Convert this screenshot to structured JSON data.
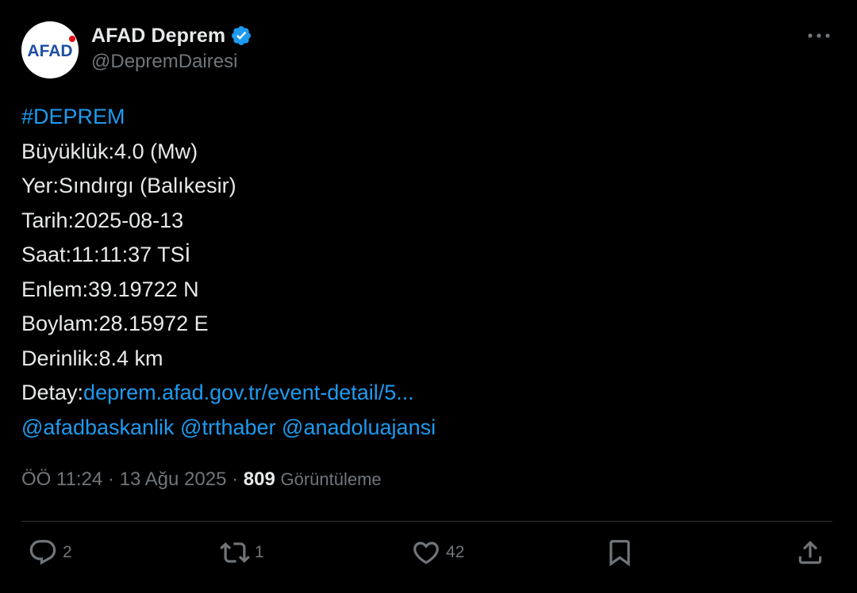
{
  "author": {
    "display_name": "AFAD Deprem",
    "handle": "@DepremDairesi",
    "avatar_text": "AFAD",
    "verified": true
  },
  "tweet": {
    "hashtag": "#DEPREM",
    "lines": {
      "magnitude": "Büyüklük:4.0 (Mw)",
      "location": "Yer:Sındırgı (Balıkesir)",
      "date": "Tarih:2025-08-13",
      "time": "Saat:11:11:37 TSİ",
      "latitude": "Enlem:39.19722 N",
      "longitude": "Boylam:28.15972 E",
      "depth": "Derinlik:8.4 km"
    },
    "detail_label": "Detay:",
    "detail_link": "deprem.afad.gov.tr/event-detail/5...",
    "mentions": [
      "@afadbaskanlik",
      "@trthaber",
      "@anadoluajansi"
    ]
  },
  "meta": {
    "timestamp": "ÖÖ 11:24 · 13 Ağu 2025 · ",
    "views_count": "809",
    "views_label": "Görüntüleme"
  },
  "actions": {
    "reply_count": "2",
    "retweet_count": "1",
    "like_count": "42"
  },
  "colors": {
    "background": "#000000",
    "text": "#e7e9ea",
    "secondary": "#71767b",
    "link": "#1d9bf0",
    "divider": "#2f3336",
    "avatar_red": "#e30a17",
    "avatar_blue": "#1f4fa3"
  },
  "icons": [
    "verified-badge-icon",
    "more-icon",
    "reply-icon",
    "retweet-icon",
    "like-icon",
    "bookmark-icon",
    "share-icon"
  ]
}
